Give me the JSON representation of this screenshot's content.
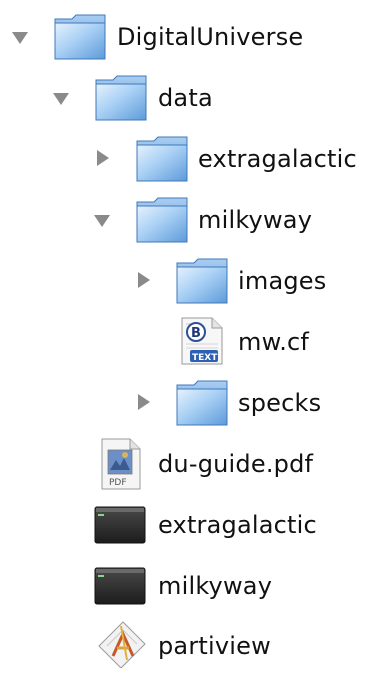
{
  "tree": {
    "items": [
      {
        "label": "DigitalUniverse",
        "icon": "folder-icon",
        "disclosure": "expanded"
      },
      {
        "label": "data",
        "icon": "folder-icon",
        "disclosure": "expanded"
      },
      {
        "label": "extragalactic",
        "icon": "folder-icon",
        "disclosure": "collapsed"
      },
      {
        "label": "milkyway",
        "icon": "folder-icon",
        "disclosure": "expanded"
      },
      {
        "label": "images",
        "icon": "folder-icon",
        "disclosure": "collapsed"
      },
      {
        "label": "mw.cf",
        "icon": "bbedit-text-file-icon",
        "disclosure": "none"
      },
      {
        "label": "specks",
        "icon": "folder-icon",
        "disclosure": "collapsed"
      },
      {
        "label": "du-guide.pdf",
        "icon": "pdf-file-icon",
        "disclosure": "none"
      },
      {
        "label": "extragalactic",
        "icon": "terminal-script-icon",
        "disclosure": "none"
      },
      {
        "label": "milkyway",
        "icon": "terminal-script-icon",
        "disclosure": "none"
      },
      {
        "label": "partiview",
        "icon": "application-icon",
        "disclosure": "none"
      }
    ]
  },
  "colors": {
    "folder_light": "#cfe6fb",
    "folder_mid": "#8fc0ee",
    "folder_dark": "#4f8fd2",
    "triangle": "#8a8a8a",
    "text": "#111111"
  }
}
